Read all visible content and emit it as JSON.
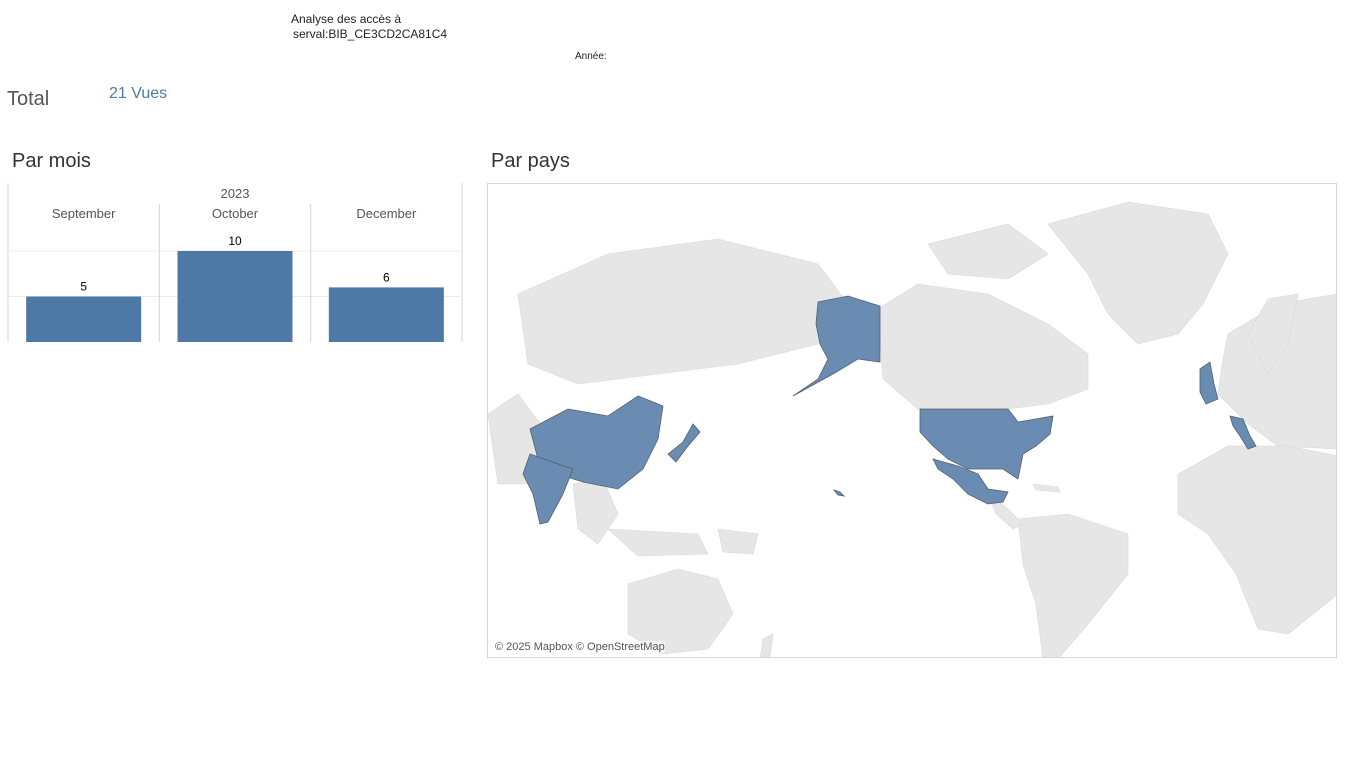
{
  "header": {
    "title_line1": "Analyse des accès à",
    "title_line2": "serval:BIB_CE3CD2CA81C4",
    "year_filter_label": "Année:"
  },
  "total": {
    "label": "Total",
    "value": "21 Vues"
  },
  "colors": {
    "accent": "#4e79a7",
    "map_highlight": "#6a8cb2",
    "map_land": "#e6e6e6"
  },
  "chart_data": [
    {
      "type": "bar",
      "title": "Par mois",
      "group_label": "2023",
      "categories": [
        "September",
        "October",
        "December"
      ],
      "values": [
        5,
        10,
        6
      ],
      "ylim": [
        0,
        10
      ],
      "grid": true,
      "data_labels": [
        "5",
        "10",
        "6"
      ]
    },
    {
      "type": "map",
      "title": "Par pays",
      "highlighted_countries": [
        "United States",
        "Mexico",
        "China",
        "India",
        "Japan",
        "United Kingdom",
        "Italy"
      ],
      "attribution": "© 2025 Mapbox © OpenStreetMap"
    }
  ]
}
